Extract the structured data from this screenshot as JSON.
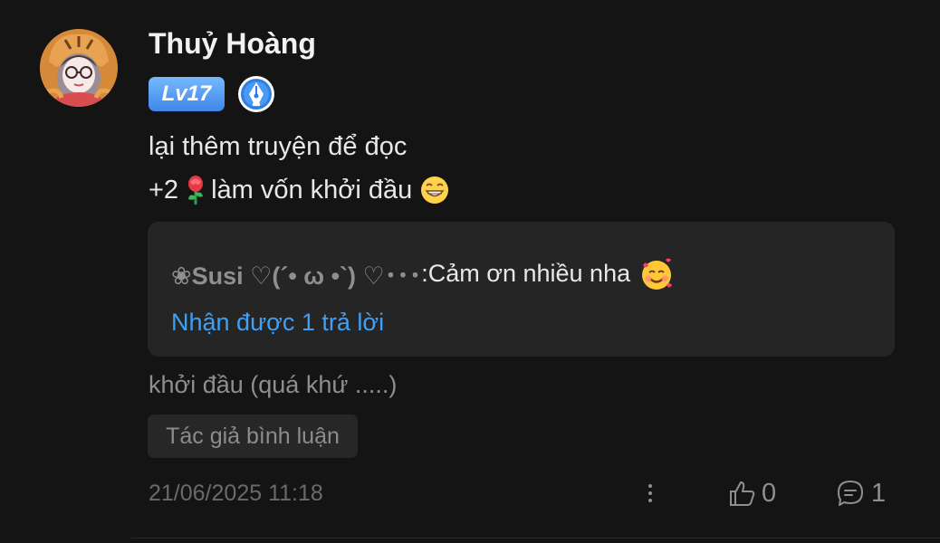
{
  "comment": {
    "author": "Thuỷ Hoàng",
    "level": "Lv17",
    "badge_icon": "pen-nib-icon",
    "text_line1": "lại thêm truyện để đọc",
    "text_line2_prefix": "+2",
    "text_line2_emoji_1": "rose-emoji",
    "text_line2_middle": "làm vốn khởi đầu",
    "text_line2_emoji_2": "grinning-face-emoji"
  },
  "reply_preview": {
    "author": "❀Susi ♡(´• ω •`) ♡･･･",
    "separator": ":",
    "text": " Cảm ơn nhiều nha",
    "emoji": "smiling-face-with-hearts-emoji",
    "reply_count_label": "Nhận được 1 trả lời"
  },
  "context": {
    "story_excerpt": "khởi đầu (quá khứ .....)",
    "tag": "Tác giả bình luận"
  },
  "footer": {
    "timestamp": "21/06/2025 11:18",
    "more_icon": "vertical-ellipsis-icon",
    "like_icon": "thumbs-up-icon",
    "like_count": "0",
    "comment_icon": "comment-bubble-icon",
    "comment_count": "1"
  },
  "colors": {
    "background": "#141414",
    "reply_box": "#252525",
    "link": "#3fa0f5",
    "level_badge": "#4f96f1"
  }
}
